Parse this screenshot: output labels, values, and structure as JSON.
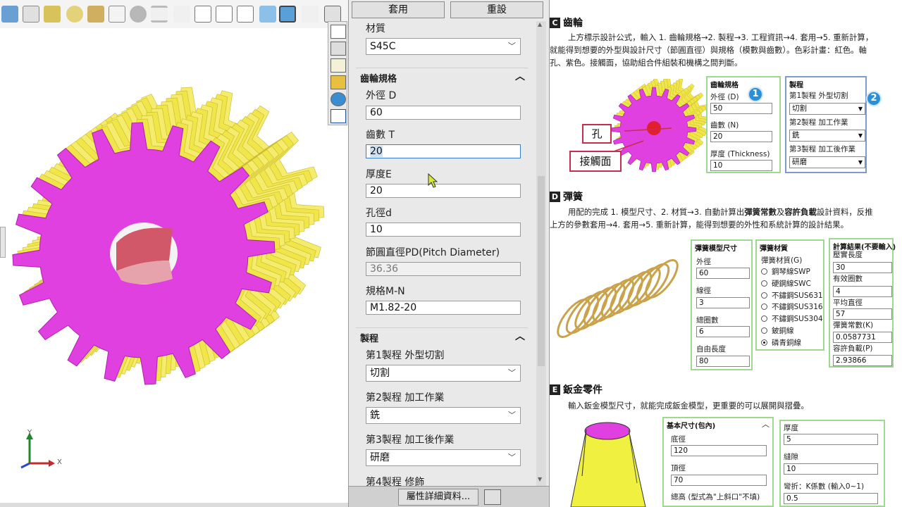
{
  "viewport": {
    "axis_y_label": "Y",
    "axis_x_label": "X"
  },
  "panel": {
    "apply_button": "套用",
    "reset_button": "重設",
    "material_label": "材質",
    "material_value": "S45C",
    "gear_spec_header": "齒輪規格",
    "outer_d_label": "外徑 D",
    "outer_d_value": "60",
    "teeth_label": "齒數 T",
    "teeth_value": "20",
    "thickness_label": "厚度E",
    "thickness_value": "20",
    "hole_label": "孔徑d",
    "hole_value": "10",
    "pitch_label": "節圓直徑PD(Pitch Diameter)",
    "pitch_value": "36.36",
    "module_label": "規格M-N",
    "module_value": "M1.82-20",
    "process_header": "製程",
    "process1_label": "第1製程  外型切割",
    "process1_value": "切割",
    "process2_label": "第2製程 加工作業",
    "process2_value": "銑",
    "process3_label": "第3製程  加工後作業",
    "process3_value": "研磨",
    "process4_label": "第4製程 修飾",
    "details_button": "屬性詳細資料..."
  },
  "doc": {
    "c": {
      "letter": "C",
      "title": "齒輪",
      "para_line1": "上方標示設計公式，輸入 1. 齒輪規格→2. 製程→3. 工程資訊→4. 套用→5. 重新計算，",
      "para_line2": "就能得到想要的外型與設計尺寸（節圓直徑）與規格（模數與齒數）。色彩計畫：紅色。軸",
      "para_line3": "孔、紫色。接觸面，協助組合件組裝和機構之間判斷。",
      "callout_hole": "孔",
      "callout_face": "接觸面",
      "box1": {
        "title": "齒輪規格",
        "od_label": "外徑 (D)",
        "od_value": "50",
        "teeth_label": "齒數 (N)",
        "teeth_value": "20",
        "thick_label": "厚度 (Thickness)",
        "thick_value": "10",
        "badge": "1"
      },
      "box2": {
        "title": "製程",
        "p1_label": "第1製程 外型切割",
        "p1_value": "切割",
        "p2_label": "第2製程 加工作業",
        "p2_value": "銑",
        "p3_label": "第3製程  加工後作業",
        "p3_value": "研磨",
        "badge": "2"
      }
    },
    "d": {
      "letter": "D",
      "title": "彈簧",
      "para_pre": "用配的完成 1. 模型尺寸、2. 材質→3. 自動計算出",
      "para_b1": "彈簧常數",
      "para_mid": "及",
      "para_b2": "容許負載",
      "para_post": "設計資料，反推",
      "para_line2": "上方的參數套用→4. 套用→5. 重新計算，能得到想要的外性和系統計算的設計結果。",
      "box1": {
        "title": "彈簧模型尺寸",
        "od_label": "外徑",
        "od_value": "60",
        "wire_label": "線徑",
        "wire_value": "3",
        "coils_label": "總圈數",
        "coils_value": "6",
        "free_label": "自由長度",
        "free_value": "80"
      },
      "box2": {
        "title": "彈簧材質",
        "sub_label": "彈簧材質(G)",
        "options": [
          "鋼琴線SWP",
          "硬鋼線SWC",
          "不鏽鋼SUS631",
          "不鏽鋼SUS316",
          "不鏽鋼SUS304",
          "鈹銅線",
          "磷青銅線"
        ]
      },
      "box3": {
        "title": "計算結果(不要輸入)",
        "comp_label": "壓實長度",
        "comp_value": "30",
        "eff_label": "有效圈數",
        "eff_value": "4",
        "mean_label": "平均直徑",
        "mean_value": "57",
        "rate_label": "彈簧常數(K)",
        "rate_value": "0.0587731",
        "load_label": "容許負載(P)",
        "load_value": "2.93866"
      }
    },
    "e": {
      "letter": "E",
      "title": "鈑金零件",
      "para": "輸入鈑金模型尺寸，就能完成鈑金模型，更重要的可以展開與摺疊。",
      "box1": {
        "title": "基本尺寸(包內)",
        "base_label": "底徑",
        "base_value": "120",
        "top_label": "頂徑",
        "top_value": "70",
        "height_label": "總高 (型式為\"上斜口\"不填)"
      },
      "box2": {
        "thick_label": "厚度",
        "thick_value": "5",
        "gap_label": "縫隙",
        "gap_value": "10",
        "k_label": "彎折：K係數 (輸入0~1)",
        "k_value": "0.5"
      }
    }
  },
  "colors": {
    "gear_face": "#e040e0",
    "gear_side": "#f0e64a",
    "hole": "#e08a90",
    "green_border": "#9fd890",
    "blue_border": "#7d9ccc",
    "badge": "#2b8ed8",
    "callout_border": "#c72d4d"
  },
  "icons": [
    "toolbar-icons",
    "home-icon",
    "parts-icon",
    "folder-icon",
    "layout-icon",
    "appearance-icon",
    "list-icon",
    "cursor-icon"
  ]
}
